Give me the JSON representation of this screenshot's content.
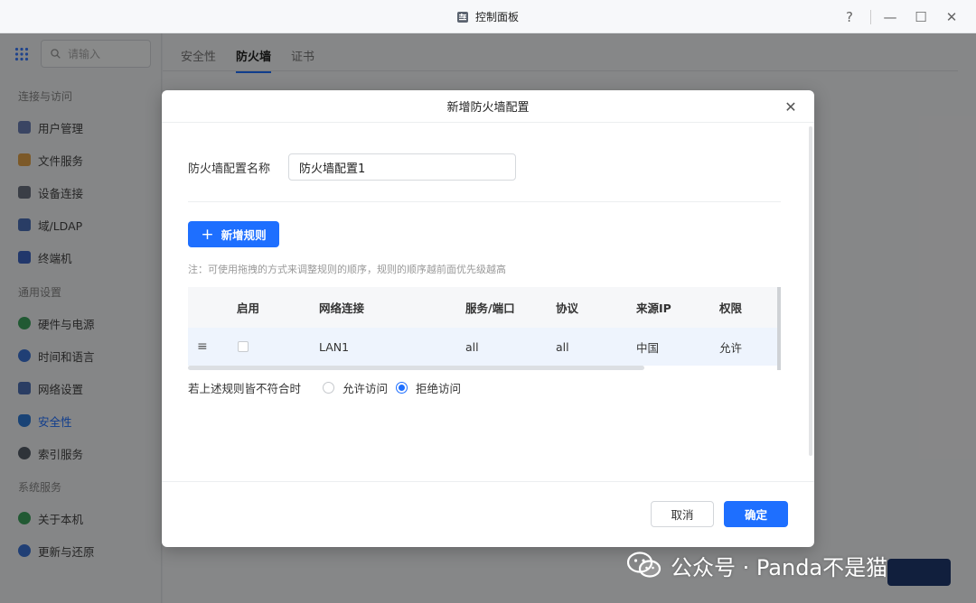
{
  "window": {
    "title": "控制面板",
    "help": "?",
    "minimize": "—",
    "maximize": "☐",
    "close": "✕"
  },
  "sidebar": {
    "search_placeholder": "请输入",
    "sections": [
      {
        "title": "连接与访问",
        "items": [
          "用户管理",
          "文件服务",
          "设备连接",
          "域/LDAP",
          "终端机"
        ]
      },
      {
        "title": "通用设置",
        "items": [
          "硬件与电源",
          "时间和语言",
          "网络设置",
          "安全性",
          "索引服务"
        ]
      },
      {
        "title": "系统服务",
        "items": [
          "关于本机",
          "更新与还原"
        ]
      }
    ],
    "active": "安全性"
  },
  "main": {
    "tabs": [
      "安全性",
      "防火墙",
      "证书"
    ],
    "active_tab": "防火墙"
  },
  "dialog": {
    "title": "新增防火墙配置",
    "name_label": "防火墙配置名称",
    "name_value": "防火墙配置1",
    "add_rule_label": "新增规则",
    "note": "注：可使用拖拽的方式来调整规则的顺序，规则的顺序越前面优先级越高",
    "table": {
      "headers": [
        "启用",
        "网络连接",
        "服务/端口",
        "协议",
        "来源IP",
        "权限"
      ],
      "rows": [
        {
          "enabled": false,
          "network": "LAN1",
          "service": "all",
          "protocol": "all",
          "source_ip": "中国",
          "permission": "允许"
        }
      ]
    },
    "fallback_label": "若上述规则皆不符合时",
    "fallback_options": [
      "允许访问",
      "拒绝访问"
    ],
    "fallback_selected": "拒绝访问",
    "cancel_label": "取消",
    "ok_label": "确定"
  },
  "watermark": "公众号 · Panda不是猫",
  "colors": {
    "accent": "#1e6fff",
    "overlay": "rgba(0,0,0,0.45)"
  }
}
